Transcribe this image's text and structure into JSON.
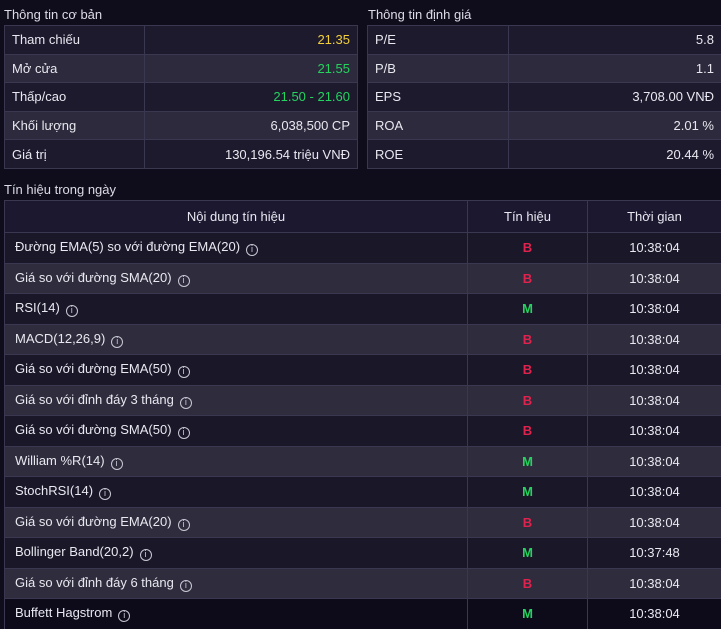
{
  "basic_info": {
    "title": "Thông tin cơ bản",
    "rows": [
      {
        "label": "Tham chiếu",
        "value": "21.35",
        "color": "yellow"
      },
      {
        "label": "Mở cửa",
        "value": "21.55",
        "color": "green"
      },
      {
        "label": "Thấp/cao",
        "value": "21.50 - 21.60",
        "color": "green"
      },
      {
        "label": "Khối lượng",
        "value": "6,038,500 CP",
        "color": ""
      },
      {
        "label": "Giá trị",
        "value": "130,196.54 triệu VNĐ",
        "color": ""
      }
    ]
  },
  "valuation": {
    "title": "Thông tin định giá",
    "rows": [
      {
        "label": "P/E",
        "value": "5.8"
      },
      {
        "label": "P/B",
        "value": "1.1"
      },
      {
        "label": "EPS",
        "value": "3,708.00 VNĐ"
      },
      {
        "label": "ROA",
        "value": "2.01 %"
      },
      {
        "label": "ROE",
        "value": "20.44 %"
      }
    ]
  },
  "signals": {
    "title": "Tín hiệu trong ngày",
    "headers": {
      "content": "Nội dung tín hiệu",
      "signal": "Tín hiệu",
      "time": "Thời gian"
    },
    "info_icon": "i",
    "rows": [
      {
        "name": "Đường EMA(5) so với đường EMA(20)",
        "signal": "B",
        "time": "10:38:04"
      },
      {
        "name": "Giá so với đường SMA(20)",
        "signal": "B",
        "time": "10:38:04"
      },
      {
        "name": "RSI(14)",
        "signal": "M",
        "time": "10:38:04"
      },
      {
        "name": "MACD(12,26,9)",
        "signal": "B",
        "time": "10:38:04"
      },
      {
        "name": "Giá so với đường EMA(50)",
        "signal": "B",
        "time": "10:38:04"
      },
      {
        "name": "Giá so với đỉnh đáy 3 tháng",
        "signal": "B",
        "time": "10:38:04"
      },
      {
        "name": "Giá so với đường SMA(50)",
        "signal": "B",
        "time": "10:38:04"
      },
      {
        "name": "William %R(14)",
        "signal": "M",
        "time": "10:38:04"
      },
      {
        "name": "StochRSI(14)",
        "signal": "M",
        "time": "10:38:04"
      },
      {
        "name": "Giá so với đường EMA(20)",
        "signal": "B",
        "time": "10:38:04"
      },
      {
        "name": "Bollinger Band(20,2)",
        "signal": "M",
        "time": "10:37:48"
      },
      {
        "name": "Giá so với đỉnh đáy 6 tháng",
        "signal": "B",
        "time": "10:38:04"
      },
      {
        "name": "Buffett Hagstrom",
        "signal": "M",
        "time": "10:38:04"
      }
    ]
  },
  "colors": {
    "buy": "#e0224e",
    "mua": "#24d45e",
    "reference": "#f2d03a"
  }
}
